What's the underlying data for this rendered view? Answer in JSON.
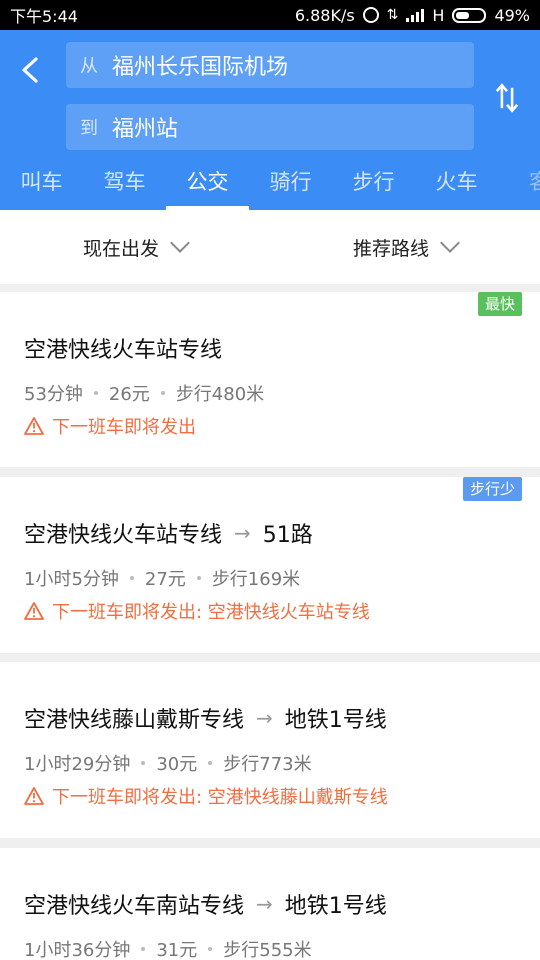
{
  "status_bar": {
    "time": "下午5:44",
    "speed": "6.88K/s",
    "network": "H",
    "battery": "49%",
    "battery_level": 0.49
  },
  "header": {
    "from_prefix": "从",
    "from_value": "福州长乐国际机场",
    "to_prefix": "到",
    "to_value": "福州站",
    "back_icon": "chevron-left-icon",
    "swap_icon": "swap-vertical-icon",
    "accent": "#3b8cf5"
  },
  "tabs": [
    {
      "label": "叫车"
    },
    {
      "label": "驾车"
    },
    {
      "label": "公交",
      "active": true
    },
    {
      "label": "骑行"
    },
    {
      "label": "步行"
    },
    {
      "label": "火车"
    },
    {
      "label": "客"
    }
  ],
  "filters": {
    "depart": "现在出发",
    "sort": "推荐路线"
  },
  "routes": [
    {
      "badge": "最快",
      "line1": "空港快线火车站专线",
      "duration": "53分钟",
      "fare": "26元",
      "walk": "步行480米",
      "warning": "下一班车即将发出"
    },
    {
      "badge": "步行少",
      "line1": "空港快线火车站专线",
      "line2": "51路",
      "duration": "1小时5分钟",
      "fare": "27元",
      "walk": "步行169米",
      "warning": "下一班车即将发出: 空港快线火车站专线"
    },
    {
      "line1": "空港快线藤山戴斯专线",
      "line2": "地铁1号线",
      "duration": "1小时29分钟",
      "fare": "30元",
      "walk": "步行773米",
      "warning": "下一班车即将发出: 空港快线藤山戴斯专线"
    },
    {
      "line1": "空港快线火车南站专线",
      "line2": "地铁1号线",
      "duration": "1小时36分钟",
      "fare": "31元",
      "walk": "步行555米"
    }
  ]
}
